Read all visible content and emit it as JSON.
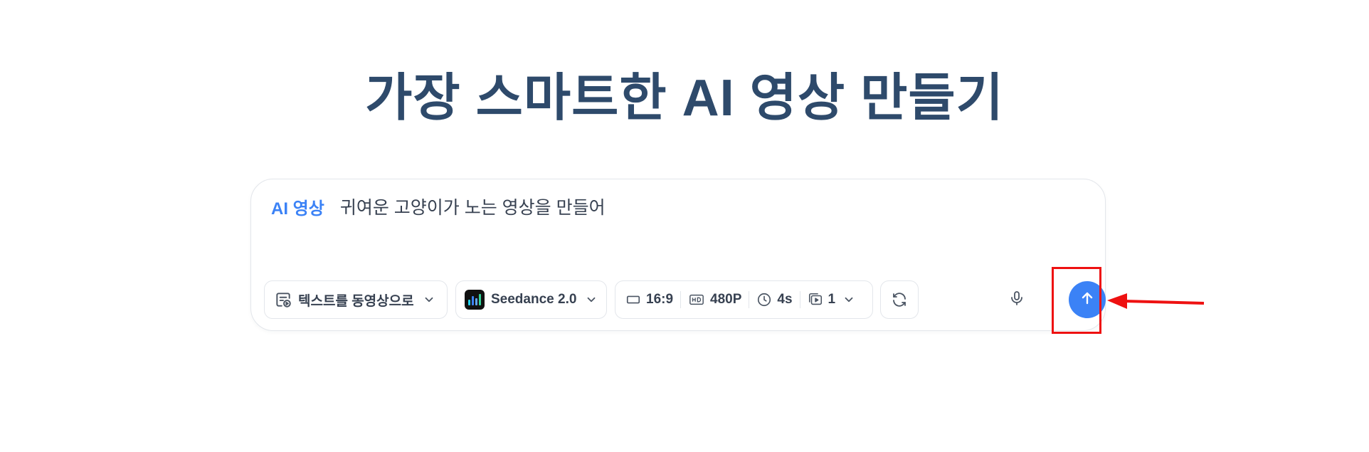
{
  "page": {
    "title": "가장 스마트한 AI 영상 만들기"
  },
  "composer": {
    "mode_tag": "AI 영상",
    "prompt_text": "귀여운 고양이가 노는 영상을 만들어"
  },
  "toolbar": {
    "mode_select": {
      "label": "텍스트를 동영상으로",
      "icon": "text-to-video-icon"
    },
    "model_select": {
      "label": "Seedance 2.0",
      "icon": "seedance-logo"
    },
    "params": {
      "aspect_ratio": "16:9",
      "resolution": "480P",
      "duration": "4s",
      "count": "1"
    },
    "refresh_icon": "refresh-icon",
    "mic_icon": "microphone-icon",
    "send_icon": "arrow-up-icon"
  },
  "colors": {
    "title": "#2e4a6b",
    "accent": "#3b82f6",
    "annotation": "#ee1111",
    "border": "#e3e6eb"
  }
}
